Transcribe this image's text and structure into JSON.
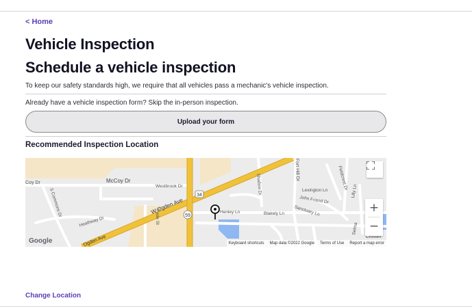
{
  "nav": {
    "home_link": "< Home"
  },
  "page": {
    "title": "Vehicle Inspection",
    "subtitle": "Schedule a vehicle inspection",
    "intro": "To keep our safety standards high, we require that all vehicles pass a mechanic's vehicle inspection.",
    "already_text": "Already have a vehicle inspection form? Skip the in-person inspection.",
    "upload_button": "Upload your form",
    "section_title": "Recommended Inspection Location",
    "change_location": "Change Location"
  },
  "map": {
    "streets": {
      "mccoy": "McCoy Dr",
      "coy": "Coy Dr",
      "westbrook": "Westbrook Dr",
      "ogden": "W Ogden Ave",
      "ogden_lower": "Ogden Ave",
      "s_commons": "S Commons Dr",
      "heathway": "Heathway Dr",
      "trade": "Trade St",
      "shadow": "Shadow Dr",
      "fort_hill": "Fort Hill Dr",
      "lexington": "Lexington Ln",
      "fieldcrest": "Fieldcrest Dr",
      "john_friend": "John Friend Dr",
      "sanctuary": "Sanctuary Ln",
      "blakely": "Blakely Ln",
      "henley": "Henley Ln",
      "lilly": "Lilly Ln",
      "selma": "Selma",
      "crossing": "Crossin"
    },
    "route_shields": [
      "34",
      "59"
    ],
    "google_logo": "Google",
    "attribution": [
      "Keyboard shortcuts",
      "Map data ©2022 Google",
      "Terms of Use",
      "Report a map error"
    ],
    "zoom_in": "+",
    "zoom_out": "−",
    "colors": {
      "highway": "#f0c23a",
      "highway_edge": "#d7a52a",
      "water": "#8fb7f2",
      "commercial": "#f5e6c8",
      "land": "#ececec",
      "park": "#d8ecd0"
    }
  }
}
